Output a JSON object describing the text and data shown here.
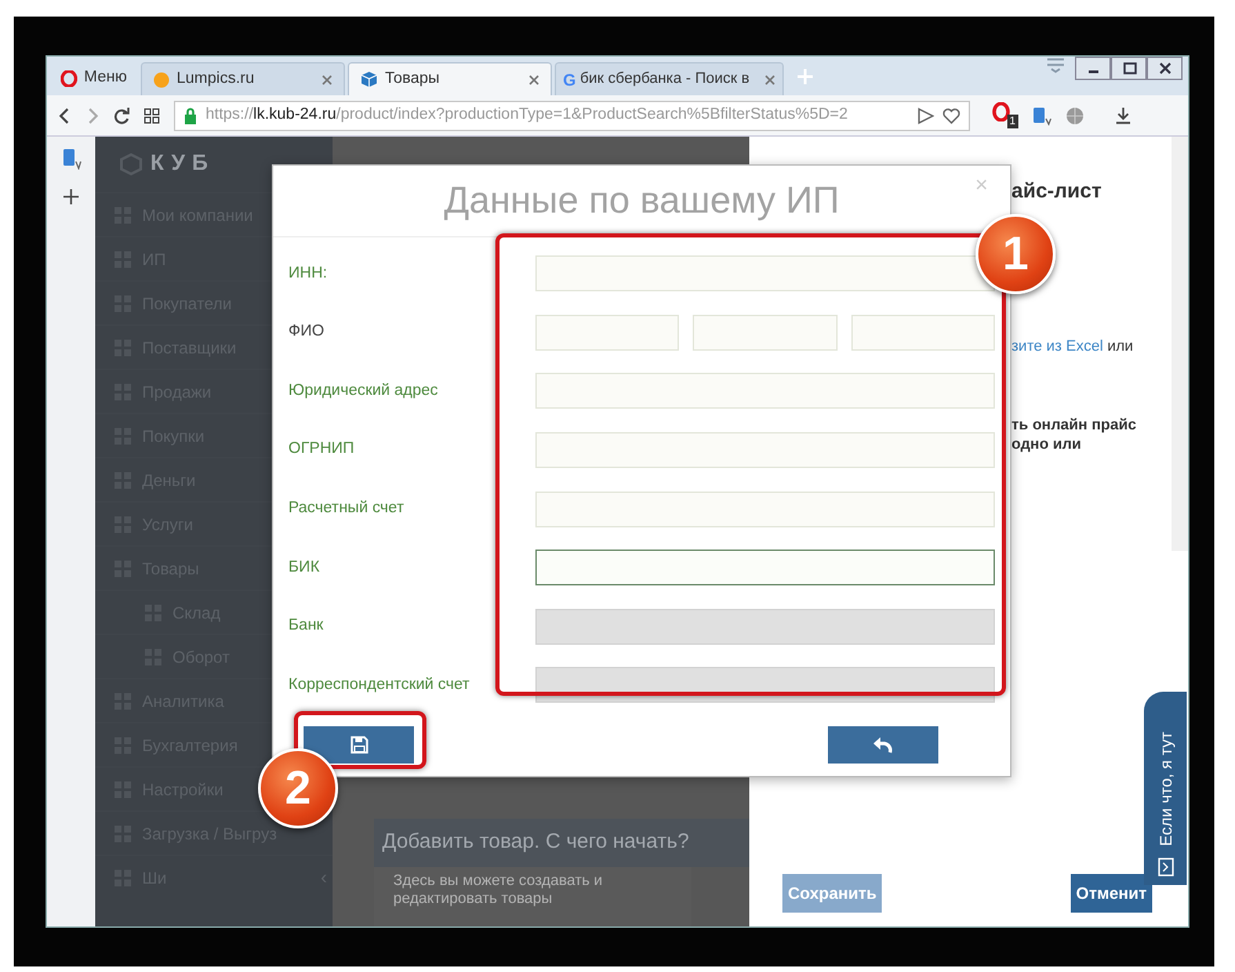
{
  "browser": {
    "tabs": [
      {
        "kind": "menu",
        "label": "Меню"
      },
      {
        "kind": "dot",
        "label": "Lumpics.ru",
        "selected": false
      },
      {
        "kind": "cube",
        "label": "Товары",
        "selected": true
      },
      {
        "kind": "letter",
        "icon_letter": "G",
        "label": "бик сбербанка - Поиск в",
        "selected": false
      }
    ],
    "url": {
      "scheme": "https://",
      "host": "lk.kub-24.ru",
      "path": "/product/index?productionType=1&ProductSearch%5BfilterStatus%5D=2"
    },
    "extension_badge": "1"
  },
  "app": {
    "logo": "КУБ",
    "sidebar": [
      {
        "label": "Мои компании"
      },
      {
        "label": "ИП"
      },
      {
        "label": "Покупатели"
      },
      {
        "label": "Поставщики"
      },
      {
        "label": "Продажи"
      },
      {
        "label": "Покупки"
      },
      {
        "label": "Деньги"
      },
      {
        "label": "Услуги"
      },
      {
        "label": "Товары",
        "children": [
          {
            "label": "Склад"
          },
          {
            "label": "Оборот"
          }
        ]
      },
      {
        "label": "Аналитика"
      },
      {
        "label": "Бухгалтерия"
      },
      {
        "label": "Настройки"
      },
      {
        "label": "Загрузка / Выгруз"
      },
      {
        "label": "Ши"
      }
    ],
    "collapse": "‹",
    "help_card": {
      "title": "Добавить товар. С чего начать?",
      "text": "Здесь вы можете создавать и редактировать товары"
    }
  },
  "right_panel": {
    "title": "айс-лист",
    "link": "зите из Excel",
    "link_after": "или",
    "bold_lines": [
      "ть онлайн прайс",
      "одно или"
    ],
    "buttons": [
      {
        "label": "Сохранить",
        "disabled": true
      },
      {
        "label": "Отменит",
        "disabled": false
      }
    ]
  },
  "modal": {
    "title": "Данные по вашему ИП",
    "close": "×",
    "fields": [
      {
        "label": "ИНН:",
        "color": "#4e8a3e",
        "kind": "single",
        "focused": false,
        "readonly": false
      },
      {
        "label": "ФИО",
        "color": "#444444",
        "kind": "triple",
        "focused": false,
        "readonly": false
      },
      {
        "label": "Юридический адрес",
        "color": "#4e8a3e",
        "kind": "single",
        "focused": false,
        "readonly": false
      },
      {
        "label": "ОГРНИП",
        "color": "#4e8a3e",
        "kind": "single",
        "focused": false,
        "readonly": false
      },
      {
        "label": "Расчетный счет",
        "color": "#4e8a3e",
        "kind": "single",
        "focused": false,
        "readonly": false
      },
      {
        "label": "БИК",
        "color": "#4e8a3e",
        "kind": "single",
        "focused": true,
        "readonly": false
      },
      {
        "label": "Банк",
        "color": "#4e8a3e",
        "kind": "single",
        "focused": false,
        "readonly": true
      },
      {
        "label": "Корреспондентский счет",
        "color": "#4e8a3e",
        "kind": "single",
        "focused": false,
        "readonly": true
      }
    ]
  },
  "callouts": [
    "1",
    "2"
  ],
  "chat_tab": "Если что, я тут"
}
